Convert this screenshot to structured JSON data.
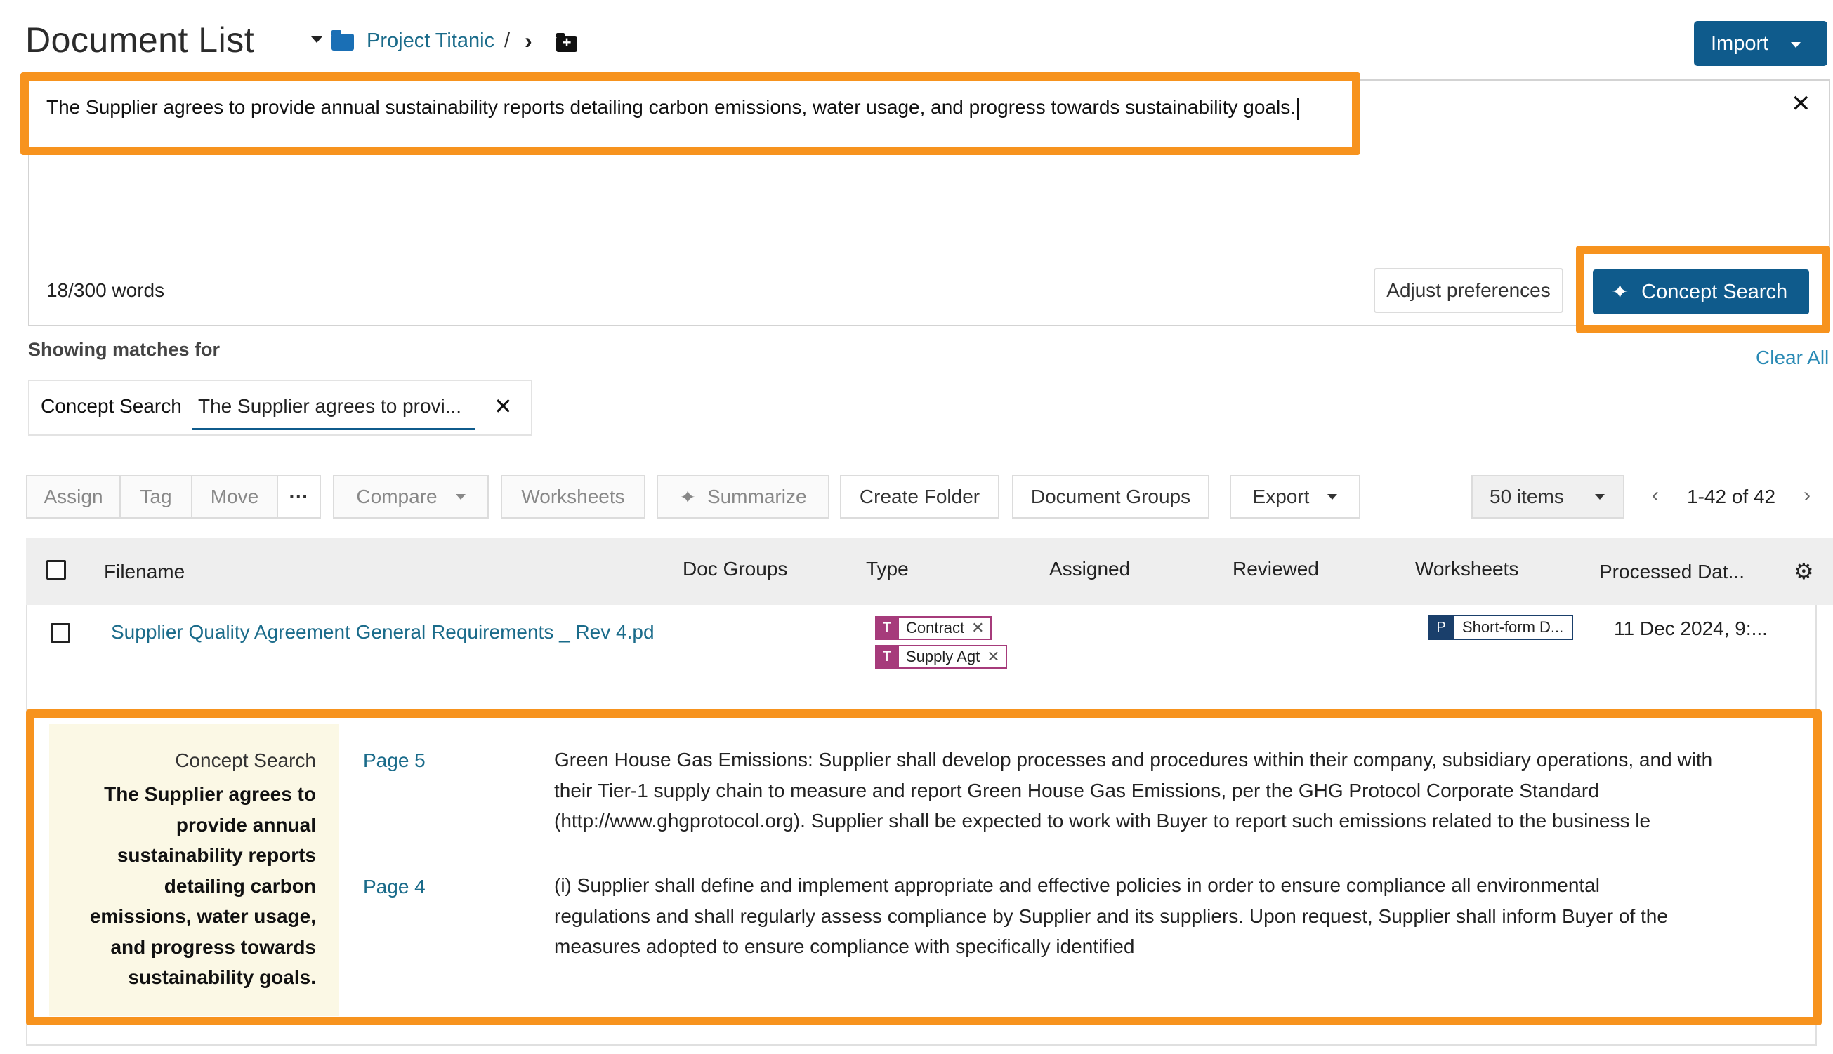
{
  "header": {
    "title": "Document List",
    "breadcrumb_project": "Project Titanic",
    "breadcrumb_separator": "/",
    "import_label": "Import"
  },
  "search": {
    "query": "The Supplier agrees to provide annual sustainability reports detailing carbon emissions, water usage, and progress towards sustainability goals.",
    "word_count": "18/300 words",
    "adjust_label": "Adjust preferences",
    "concept_search_label": "Concept Search"
  },
  "filters": {
    "showing_label": "Showing matches for",
    "clear_all": "Clear All",
    "chip_label": "Concept Search",
    "chip_value": "The Supplier agrees to provi..."
  },
  "toolbar": {
    "assign": "Assign",
    "tag": "Tag",
    "move": "Move",
    "more": "···",
    "compare": "Compare",
    "worksheets": "Worksheets",
    "summarize": "Summarize",
    "create_folder": "Create Folder",
    "document_groups": "Document Groups",
    "export": "Export",
    "page_size": "50 items",
    "pagination": "1-42 of 42"
  },
  "table": {
    "columns": {
      "filename": "Filename",
      "doc_groups": "Doc Groups",
      "type": "Type",
      "assigned": "Assigned",
      "reviewed": "Reviewed",
      "worksheets": "Worksheets",
      "processed": "Processed Dat..."
    },
    "rows": [
      {
        "filename": "Supplier Quality Agreement General Requirements _ Rev 4.pd",
        "types": [
          {
            "badge": "T",
            "label": "Contract"
          },
          {
            "badge": "T",
            "label": "Supply Agt"
          }
        ],
        "worksheet": {
          "badge": "P",
          "label": "Short-form D..."
        },
        "processed": "11 Dec 2024, 9:..."
      }
    ]
  },
  "matches": {
    "kind": "Concept Search",
    "query_lines": [
      "The Supplier agrees to",
      "provide annual",
      "sustainability reports",
      "detailing carbon",
      "emissions, water usage,",
      "and progress towards",
      "sustainability goals."
    ],
    "items": [
      {
        "page": "Page 5",
        "lines": [
          "Green House Gas Emissions: Supplier shall develop processes and procedures within their company, subsidiary operations, and with",
          "their Tier-1 supply chain to measure and report Green House Gas Emissions, per the GHG Protocol Corporate Standard",
          "(http://www.ghgprotocol.org). Supplier shall be expected to work with Buyer to report such emissions related to the business le"
        ]
      },
      {
        "page": "Page 4",
        "lines": [
          "(i) Supplier shall define and implement appropriate and effective policies in order to ensure compliance all environmental",
          "regulations and shall regularly assess compliance by Supplier and its suppliers. Upon request, Supplier shall inform Buyer of the",
          "measures adopted to ensure compliance with specifically identified"
        ]
      }
    ]
  },
  "colors": {
    "primary": "#0f5b8c",
    "link": "#1a6b8a",
    "highlight": "#f7931e",
    "tag": "#a63b7b",
    "worksheet_tag": "#1a3f6b",
    "match_bg": "#fbf8e5"
  }
}
